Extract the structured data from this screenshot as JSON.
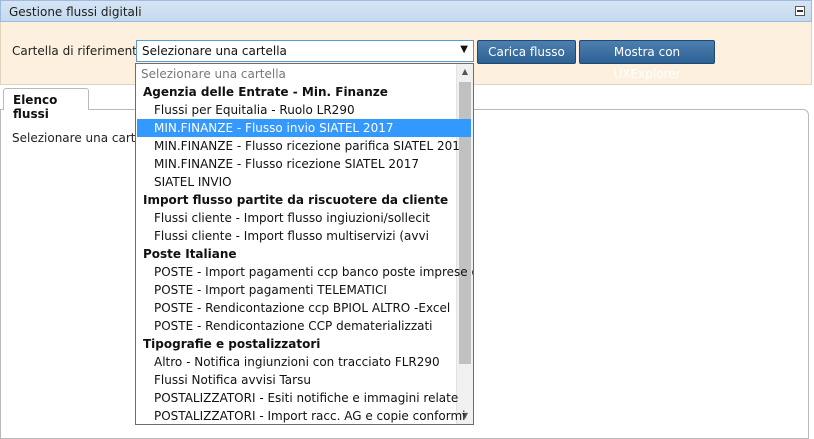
{
  "titlebar": {
    "title": "Gestione flussi digitali"
  },
  "filter": {
    "label": "Cartella di riferimento",
    "select_value": "Selezionare una cartella",
    "load_button": "Carica flusso",
    "show_button": "Mostra con UXExplorer"
  },
  "tabs": [
    {
      "label": "Elenco flussi"
    }
  ],
  "panel": {
    "message": "Selezionare una cartella"
  },
  "dropdown": {
    "items": [
      {
        "type": "placeholder",
        "label": "Selezionare una cartella"
      },
      {
        "type": "group",
        "label": "Agenzia delle Entrate - Min. Finanze"
      },
      {
        "type": "option",
        "label": "Flussi per Equitalia - Ruolo LR290"
      },
      {
        "type": "option",
        "label": "MIN.FINANZE - Flusso invio SIATEL 2017",
        "selected": true
      },
      {
        "type": "option",
        "label": "MIN.FINANZE - Flusso ricezione parifica SIATEL 201"
      },
      {
        "type": "option",
        "label": "MIN.FINANZE - Flusso ricezione SIATEL 2017"
      },
      {
        "type": "option",
        "label": "SIATEL INVIO"
      },
      {
        "type": "group",
        "label": "Import flusso partite da riscuotere da cliente"
      },
      {
        "type": "option",
        "label": "Flussi cliente - Import flusso ingiuzioni/sollecit"
      },
      {
        "type": "option",
        "label": "Flussi cliente - Import flusso multiservizi (avvi"
      },
      {
        "type": "group",
        "label": "Poste Italiane"
      },
      {
        "type": "option",
        "label": "POSTE - Import pagamenti ccp banco poste imprese o"
      },
      {
        "type": "option",
        "label": "POSTE - Import pagamenti TELEMATICI"
      },
      {
        "type": "option",
        "label": "POSTE - Rendicontazione ccp BPIOL ALTRO -Excel"
      },
      {
        "type": "option",
        "label": "POSTE - Rendicontazione CCP dematerializzati"
      },
      {
        "type": "group",
        "label": "Tipografie e postalizzatori"
      },
      {
        "type": "option",
        "label": "Altro - Notifica ingiunzioni con tracciato FLR290"
      },
      {
        "type": "option",
        "label": "Flussi Notifica avvisi Tarsu"
      },
      {
        "type": "option",
        "label": "POSTALIZZATORI - Esiti notifiche e immagini relate"
      },
      {
        "type": "option",
        "label": "POSTALIZZATORI - Import racc. AG e copie conformi"
      }
    ]
  }
}
